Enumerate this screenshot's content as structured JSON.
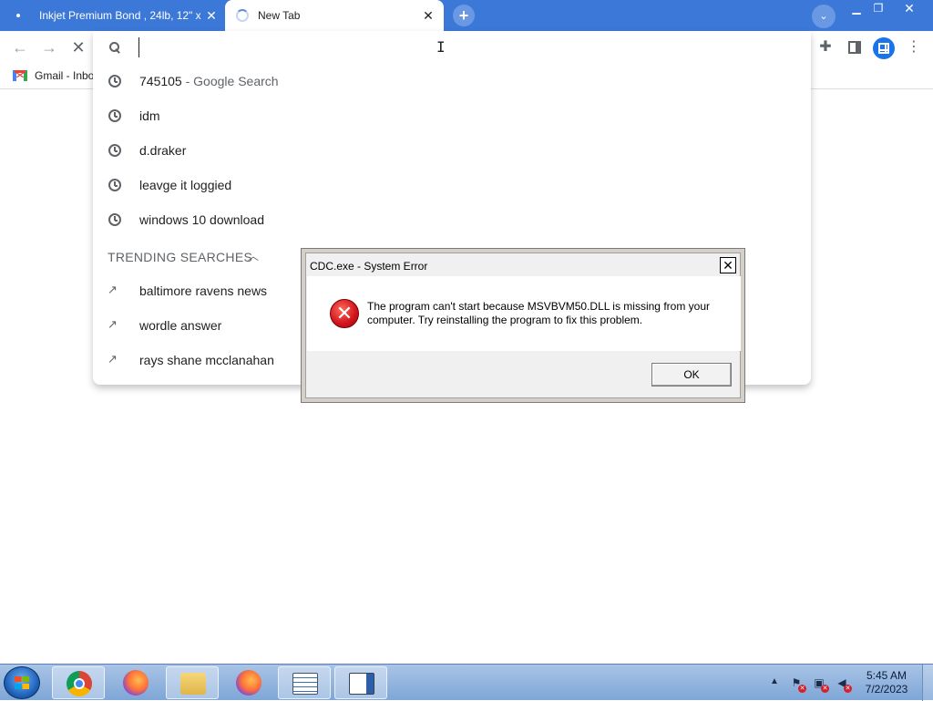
{
  "browser": {
    "tabs": [
      {
        "title": "Inkjet Premium Bond , 24lb, 12\" x",
        "active": false
      },
      {
        "title": "New Tab",
        "active": true
      }
    ],
    "close_glyph": "✕",
    "new_tab_glyph": "+",
    "tab_search_glyph": "⌄",
    "window_controls": {
      "minimize": "▁",
      "maximize": "❐",
      "close": "✕"
    },
    "bookmarks": [
      {
        "label": "Gmail - Inbo",
        "icon": "gmail-icon"
      }
    ],
    "colors": {
      "tabstrip": "#3c78d8",
      "accent": "#1a73e8"
    }
  },
  "omnibox": {
    "value": "",
    "suggestions": [
      {
        "text": "745105",
        "suffix": " - Google Search",
        "icon": "history-icon"
      },
      {
        "text": "idm",
        "suffix": "",
        "icon": "history-icon"
      },
      {
        "text": "d.draker",
        "suffix": "",
        "icon": "history-icon"
      },
      {
        "text": "leavge it loggied",
        "suffix": "",
        "icon": "history-icon"
      },
      {
        "text": "windows 10 download",
        "suffix": "",
        "icon": "history-icon"
      }
    ],
    "trending_header": "TRENDING SEARCHES",
    "trending": [
      {
        "text": "baltimore ravens news",
        "icon": "trending-icon"
      },
      {
        "text": "wordle answer",
        "icon": "trending-icon"
      },
      {
        "text": "rays shane mcclanahan",
        "icon": "trending-icon"
      }
    ]
  },
  "dialog": {
    "title": "CDC.exe - System Error",
    "message": "The program can't start because MSVBVM50.DLL is missing from your computer. Try reinstalling the program to fix this problem.",
    "ok_label": "OK",
    "close_glyph": "✕",
    "error_glyph": "✕",
    "icon": "error-icon"
  },
  "taskbar": {
    "apps": [
      "chrome",
      "firefox",
      "file-explorer",
      "firefox",
      "notepad",
      "application"
    ],
    "clock_time": "5:45 AM",
    "clock_date": "7/2/2023"
  }
}
